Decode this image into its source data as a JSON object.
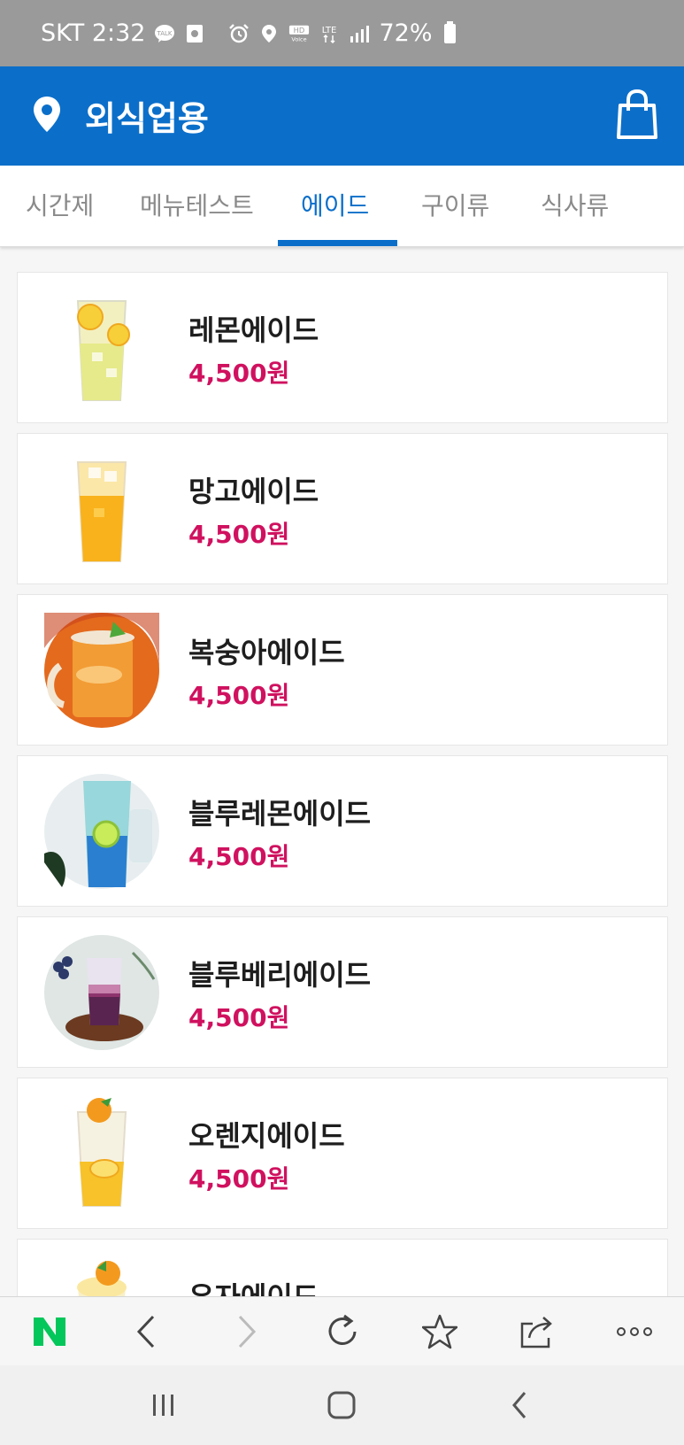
{
  "status_bar": {
    "carrier_time": "SKT 2:32",
    "talk_badge": "TALK",
    "network": "LTE",
    "hd_voice": "HD Voice",
    "battery": "72%"
  },
  "header": {
    "title": "외식업용"
  },
  "tabs": [
    {
      "label": "시간제",
      "active": false
    },
    {
      "label": "메뉴테스트",
      "active": false
    },
    {
      "label": "에이드",
      "active": true
    },
    {
      "label": "구이류",
      "active": false
    },
    {
      "label": "식사류",
      "active": false
    }
  ],
  "products": [
    {
      "name": "레몬에이드",
      "price": "4,500원",
      "thumb": "glass"
    },
    {
      "name": "망고에이드",
      "price": "4,500원",
      "thumb": "glass"
    },
    {
      "name": "복숭아에이드",
      "price": "4,500원",
      "thumb": "circle"
    },
    {
      "name": "블루레몬에이드",
      "price": "4,500원",
      "thumb": "circle"
    },
    {
      "name": "블루베리에이드",
      "price": "4,500원",
      "thumb": "circle"
    },
    {
      "name": "오렌지에이드",
      "price": "4,500원",
      "thumb": "glass"
    },
    {
      "name": "유자에이드",
      "price": "",
      "thumb": "glass"
    }
  ],
  "browser_bar": {
    "logo": "N",
    "icons": [
      "back-icon",
      "forward-icon",
      "refresh-icon",
      "star-icon",
      "share-icon",
      "more-icon"
    ]
  },
  "colors": {
    "brand_blue": "#0b6fca",
    "price_pink": "#d0115f",
    "naver_green": "#03c75a"
  }
}
